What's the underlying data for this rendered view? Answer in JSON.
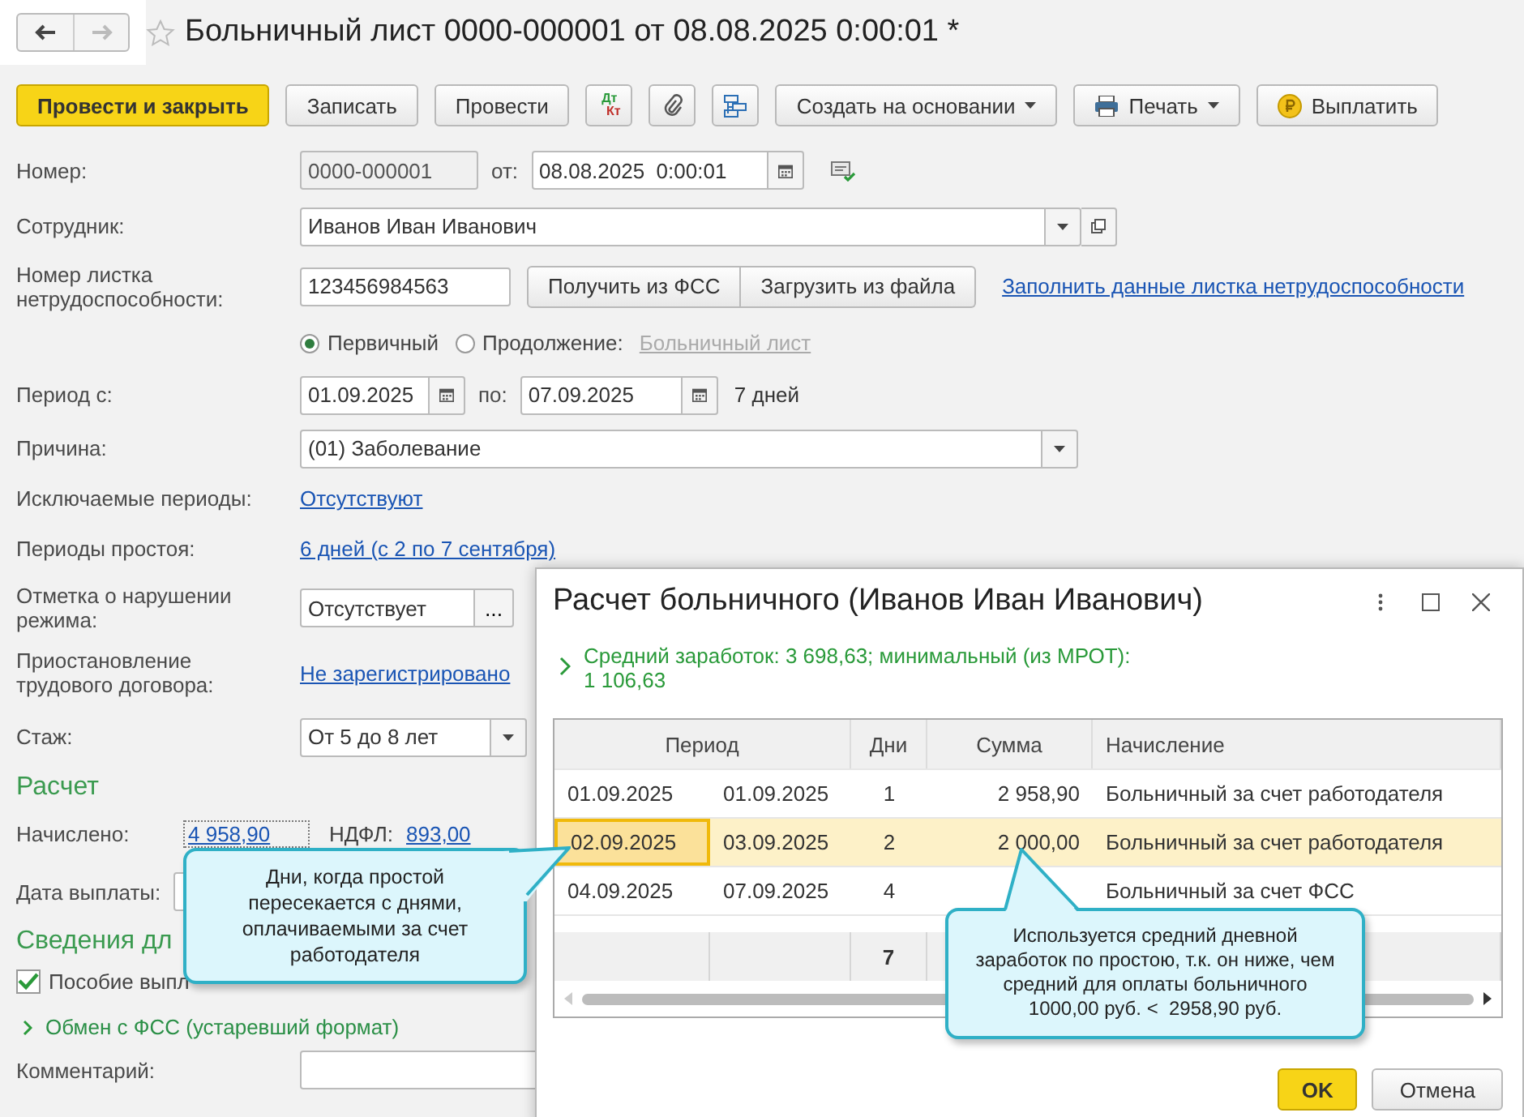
{
  "window": {
    "title": "Больничный лист 0000-000001 от 08.08.2025 0:00:01 *"
  },
  "toolbar": [
    {
      "kind": "primary",
      "label": "Провести и закрыть"
    },
    {
      "kind": "plain",
      "label": "Записать"
    },
    {
      "kind": "plain",
      "label": "Провести"
    },
    {
      "kind": "dtkt",
      "top": "Дт",
      "bottom": "Кт"
    },
    {
      "kind": "clip"
    },
    {
      "kind": "tree"
    },
    {
      "kind": "menu",
      "label": "Создать на основании"
    },
    {
      "kind": "print",
      "label": "Печать"
    },
    {
      "kind": "pay",
      "label": "Выплатить"
    }
  ],
  "form": {
    "number": {
      "label": "Номер:",
      "value": "0000-000001",
      "disabled": true,
      "date_label": "от:",
      "date": "08.08.2025  0:00:01"
    },
    "employee": {
      "label": "Сотрудник:",
      "value": "Иванов Иван Иванович"
    },
    "sheet": {
      "label": "Номер листка нетрудоспособности:",
      "value": "123456984563",
      "buttons": [
        "Получить из ФСС",
        "Загрузить из файла"
      ],
      "link": "Заполнить данные листка нетрудоспособности"
    },
    "sheet_type": [
      {
        "label": "Первичный",
        "selected": true
      },
      {
        "label": "Продолжение:",
        "selected": false
      }
    ],
    "continuation": {
      "text": "Больничный лист",
      "disabled": true
    },
    "period": {
      "label": "Период с:",
      "from": "01.09.2025",
      "to_label": "по:",
      "to": "07.09.2025",
      "days": "7 дней"
    },
    "reason": {
      "label": "Причина:",
      "value": "(01) Заболевание"
    },
    "excluded": {
      "label": "Исключаемые периоды:",
      "link": "Отсутствуют"
    },
    "idle": {
      "label": "Периоды простоя:",
      "link": "6 дней (с 2 по 7 сентября)"
    },
    "violation": {
      "label": "Отметка о нарушении режима:",
      "value": "Отсутствует",
      "button": "..."
    },
    "suspension": {
      "label": "Приостановление трудового договора:",
      "link": "Не зарегистрировано"
    },
    "experience": {
      "label": "Стаж:",
      "value": "От 5 до 8 лет"
    }
  },
  "calc": {
    "heading": "Расчет",
    "accrued_label": "Начислено:",
    "accrued": "4 958,90",
    "ndfl_label": "НДФЛ:",
    "ndfl": "893,00",
    "pay_date_label": "Дата выплаты:"
  },
  "fss": {
    "heading": "Сведения дл",
    "benefit": {
      "label": "Пособие выпл",
      "checked": true
    },
    "exchange": "Обмен с ФСС (устаревший формат)",
    "comment_label": "Комментарий:"
  },
  "dialog": {
    "title": "Расчет больничного (Иванов Иван Иванович)",
    "summary": "Средний заработок: 3 698,63; минимальный (из МРОТ):\n1 106,63",
    "table": {
      "columns": [
        "Период",
        "Дни",
        "Сумма",
        "Начисление"
      ],
      "rows": [
        {
          "from": "01.09.2025",
          "to": "01.09.2025",
          "days": "1",
          "sum": "2 958,90",
          "accrual": "Больничный за счет работодателя",
          "selected": false
        },
        {
          "from": "02.09.2025",
          "to": "03.09.2025",
          "days": "2",
          "sum": "2 000,00",
          "accrual": "Больничный за счет работодателя",
          "selected": true
        },
        {
          "from": "04.09.2025",
          "to": "07.09.2025",
          "days": "4",
          "accrual": "Больничный за счет ФСС",
          "selected": false
        }
      ],
      "total_days": "7"
    },
    "buttons": [
      {
        "kind": "primary",
        "label": "OK"
      },
      {
        "kind": "plain",
        "label": "Отмена"
      }
    ]
  },
  "callouts": [
    {
      "text": "Дни, когда простой пересекается с днями, оплачиваемыми за счет работодателя"
    },
    {
      "text": "Используется средний дневной\nзаработок по простою, т.к. он ниже, чем\nсредний для оплаты больничного\n1000,00 руб. <  2958,90 руб."
    }
  ]
}
